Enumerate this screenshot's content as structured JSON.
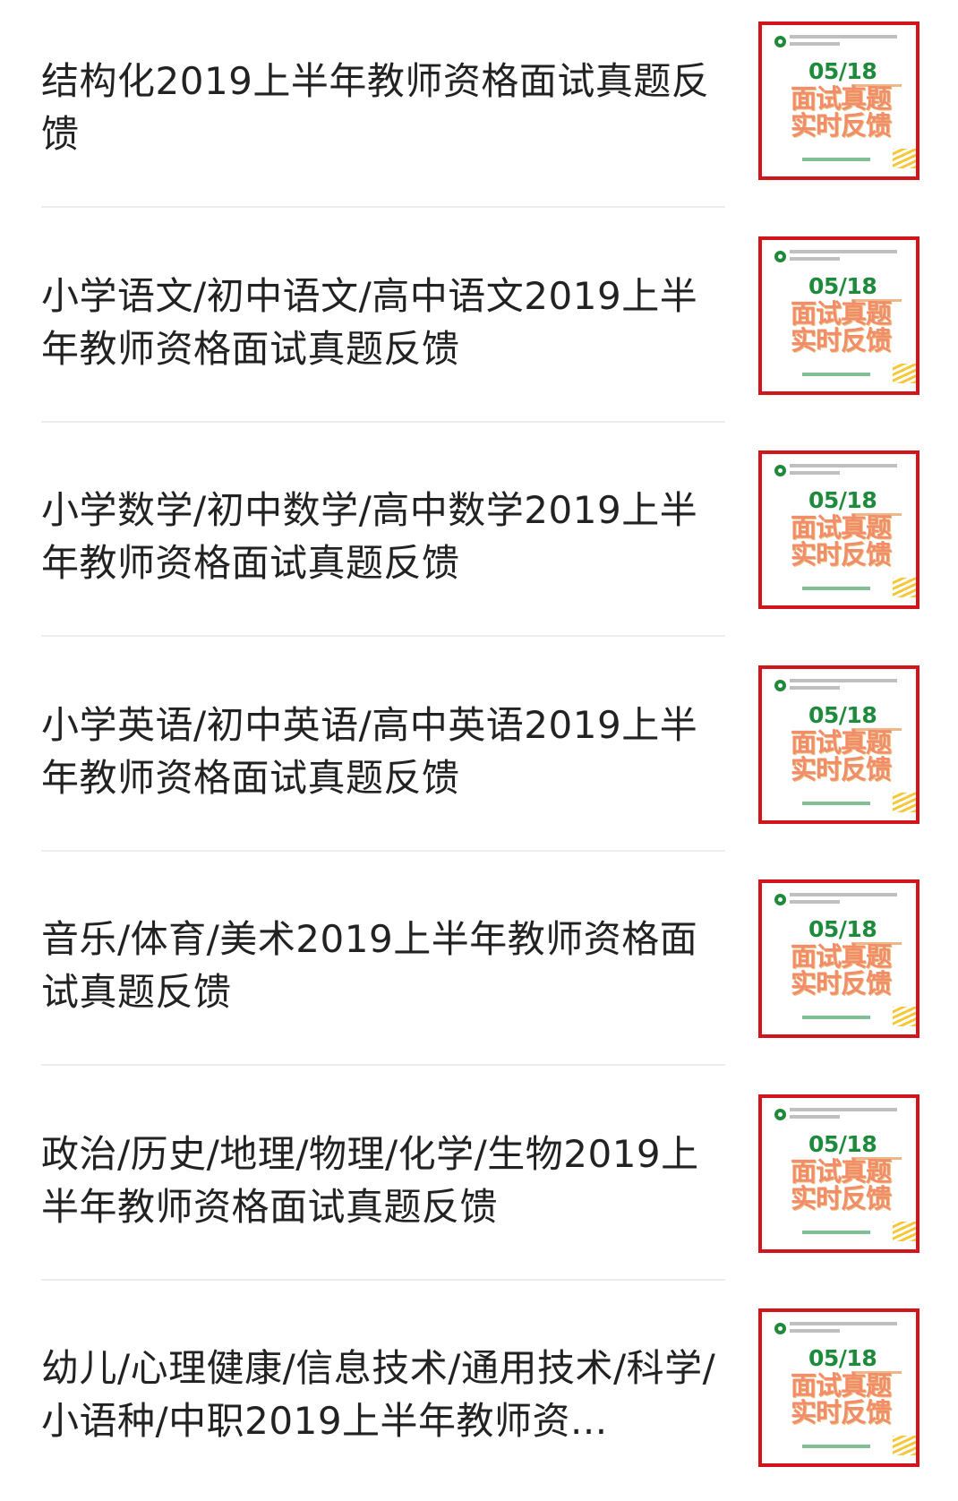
{
  "items": [
    {
      "title": "结构化2019上半年教师资格面试真题反馈",
      "thumbnail": {
        "date": "05/18",
        "line1": "面试真题",
        "line2": "实时反馈",
        "logo": "green-circle-logo-icon"
      }
    },
    {
      "title": "小学语文/初中语文/高中语文2019上半年教师资格面试真题反馈",
      "thumbnail": {
        "date": "05/18",
        "line1": "面试真题",
        "line2": "实时反馈",
        "logo": "green-circle-logo-icon"
      }
    },
    {
      "title": "小学数学/初中数学/高中数学2019上半年教师资格面试真题反馈",
      "thumbnail": {
        "date": "05/18",
        "line1": "面试真题",
        "line2": "实时反馈",
        "logo": "green-circle-logo-icon"
      }
    },
    {
      "title": "小学英语/初中英语/高中英语2019上半年教师资格面试真题反馈",
      "thumbnail": {
        "date": "05/18",
        "line1": "面试真题",
        "line2": "实时反馈",
        "logo": "green-circle-logo-icon"
      }
    },
    {
      "title": "音乐/体育/美术2019上半年教师资格面试真题反馈",
      "thumbnail": {
        "date": "05/18",
        "line1": "面试真题",
        "line2": "实时反馈",
        "logo": "green-circle-logo-icon"
      }
    },
    {
      "title": "政治/历史/地理/物理/化学/生物2019上半年教师资格面试真题反馈",
      "thumbnail": {
        "date": "05/18",
        "line1": "面试真题",
        "line2": "实时反馈",
        "logo": "green-circle-logo-icon"
      }
    },
    {
      "title": "幼儿/心理健康/信息技术/通用技术/科学/小语种/中职2019上半年教师资...",
      "thumbnail": {
        "date": "05/18",
        "line1": "面试真题",
        "line2": "实时反馈",
        "logo": "green-circle-logo-icon"
      }
    }
  ],
  "colors": {
    "title_text": "#222222",
    "divider": "#ececec",
    "thumb_border": "#d3141c",
    "thumb_date": "#1e8a3c",
    "thumb_headline": "#f28c6a"
  }
}
